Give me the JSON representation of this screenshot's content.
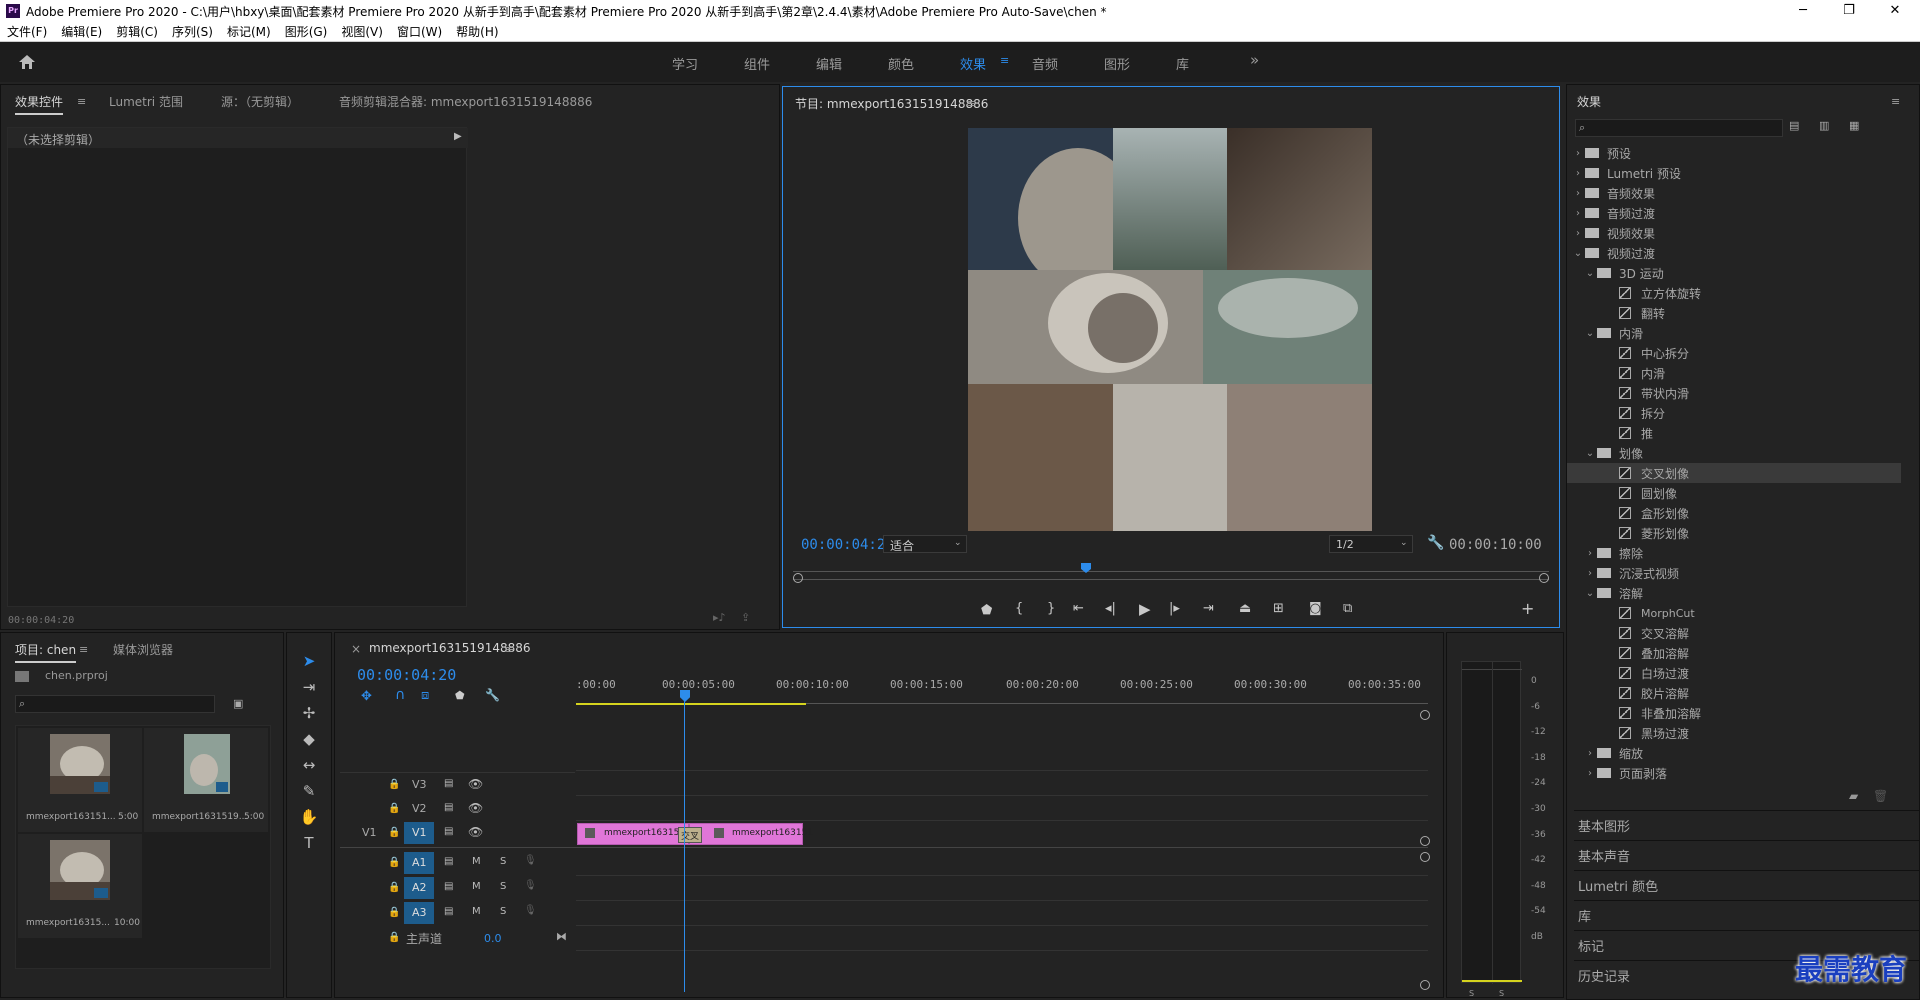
{
  "window": {
    "title": "Adobe Premiere Pro 2020 - C:\\用户\\hbxy\\桌面\\配套素材 Premiere Pro 2020 从新手到高手\\配套素材 Premiere Pro 2020 从新手到高手\\第2章\\2.4.4\\素材\\Adobe Premiere Pro Auto-Save\\chen *",
    "app_icon": "Pr",
    "min": "─",
    "max": "❐",
    "close": "✕"
  },
  "menu": [
    "文件(F)",
    "编辑(E)",
    "剪辑(C)",
    "序列(S)",
    "标记(M)",
    "图形(G)",
    "视图(V)",
    "窗口(W)",
    "帮助(H)"
  ],
  "workspaces": [
    "学习",
    "组件",
    "编辑",
    "颜色",
    "效果",
    "音频",
    "图形",
    "库"
  ],
  "active_workspace": "效果",
  "more": "»",
  "source_panel": {
    "tabs": [
      "效果控件",
      "Lumetri 范围",
      "源：（无剪辑）",
      "音频剪辑混合器: mmexport1631519148886"
    ],
    "no_clip": "（未选择剪辑）",
    "timecode": "00:00:04:20"
  },
  "program": {
    "tab": "节目: mmexport1631519148886",
    "timecode": "00:00:04:20",
    "fit": "适合",
    "quality": "1/2",
    "duration": "00:00:10:00"
  },
  "effects": {
    "title": "效果",
    "tree": [
      {
        "label": "预设",
        "level": 0,
        "type": "folder",
        "open": false
      },
      {
        "label": "Lumetri 预设",
        "level": 0,
        "type": "folder",
        "open": false
      },
      {
        "label": "音频效果",
        "level": 0,
        "type": "folder",
        "open": false
      },
      {
        "label": "音频过渡",
        "level": 0,
        "type": "folder",
        "open": false
      },
      {
        "label": "视频效果",
        "level": 0,
        "type": "folder",
        "open": false
      },
      {
        "label": "视频过渡",
        "level": 0,
        "type": "folder",
        "open": true
      },
      {
        "label": "3D 运动",
        "level": 1,
        "type": "folder",
        "open": true
      },
      {
        "label": "立方体旋转",
        "level": 2,
        "type": "fx"
      },
      {
        "label": "翻转",
        "level": 2,
        "type": "fx"
      },
      {
        "label": "内滑",
        "level": 1,
        "type": "folder",
        "open": true
      },
      {
        "label": "中心拆分",
        "level": 2,
        "type": "fx"
      },
      {
        "label": "内滑",
        "level": 2,
        "type": "fx"
      },
      {
        "label": "带状内滑",
        "level": 2,
        "type": "fx"
      },
      {
        "label": "拆分",
        "level": 2,
        "type": "fx"
      },
      {
        "label": "推",
        "level": 2,
        "type": "fx"
      },
      {
        "label": "划像",
        "level": 1,
        "type": "folder",
        "open": true
      },
      {
        "label": "交叉划像",
        "level": 2,
        "type": "fx",
        "selected": true
      },
      {
        "label": "圆划像",
        "level": 2,
        "type": "fx"
      },
      {
        "label": "盒形划像",
        "level": 2,
        "type": "fx"
      },
      {
        "label": "菱形划像",
        "level": 2,
        "type": "fx"
      },
      {
        "label": "擦除",
        "level": 1,
        "type": "folder",
        "open": false
      },
      {
        "label": "沉浸式视频",
        "level": 1,
        "type": "folder",
        "open": false
      },
      {
        "label": "溶解",
        "level": 1,
        "type": "folder",
        "open": true
      },
      {
        "label": "MorphCut",
        "level": 2,
        "type": "fx"
      },
      {
        "label": "交叉溶解",
        "level": 2,
        "type": "fx"
      },
      {
        "label": "叠加溶解",
        "level": 2,
        "type": "fx"
      },
      {
        "label": "白场过渡",
        "level": 2,
        "type": "fx"
      },
      {
        "label": "胶片溶解",
        "level": 2,
        "type": "fx"
      },
      {
        "label": "非叠加溶解",
        "level": 2,
        "type": "fx"
      },
      {
        "label": "黑场过渡",
        "level": 2,
        "type": "fx"
      },
      {
        "label": "缩放",
        "level": 1,
        "type": "folder",
        "open": false
      },
      {
        "label": "页面剥落",
        "level": 1,
        "type": "folder",
        "open": false
      }
    ],
    "side_panels": [
      "基本图形",
      "基本声音",
      "Lumetri 颜色",
      "库",
      "标记",
      "历史记录"
    ]
  },
  "project": {
    "tabs": [
      "项目: chen",
      "媒体浏览器"
    ],
    "file": "chen.prproj",
    "items": [
      {
        "name": "mmexport163151...",
        "duration": "5:00"
      },
      {
        "name": "mmexport1631519...",
        "duration": "5:00"
      },
      {
        "name": "mmexport16315...",
        "duration": "10:00"
      }
    ]
  },
  "timeline": {
    "tab": "mmexport1631519148886",
    "close": "×",
    "timecode": "00:00:04:20",
    "ruler": [
      ":00:00",
      "00:00:05:00",
      "00:00:10:00",
      "00:00:15:00",
      "00:00:20:00",
      "00:00:25:00",
      "00:00:30:00",
      "00:00:35:00"
    ],
    "tracks_video": [
      "V3",
      "V2",
      "V1"
    ],
    "tracks_audio": [
      "A1",
      "A2",
      "A3"
    ],
    "source_patch": "V1",
    "master": "主声道",
    "master_value": "0.0",
    "clips": [
      {
        "name": "mmexport163151"
      },
      {
        "name": "mmexport163151"
      }
    ],
    "transition_label": "交叉"
  },
  "meter": {
    "scale": [
      "0",
      "-6",
      "-12",
      "-18",
      "-24",
      "-30",
      "-36",
      "-42",
      "-48",
      "-54",
      "dB"
    ],
    "solo": [
      "S",
      "S"
    ]
  },
  "watermark": "最需教育",
  "colors": {
    "accent": "#2d8ceb",
    "clip": "#e076d8",
    "patch": "#1d5c8c"
  }
}
